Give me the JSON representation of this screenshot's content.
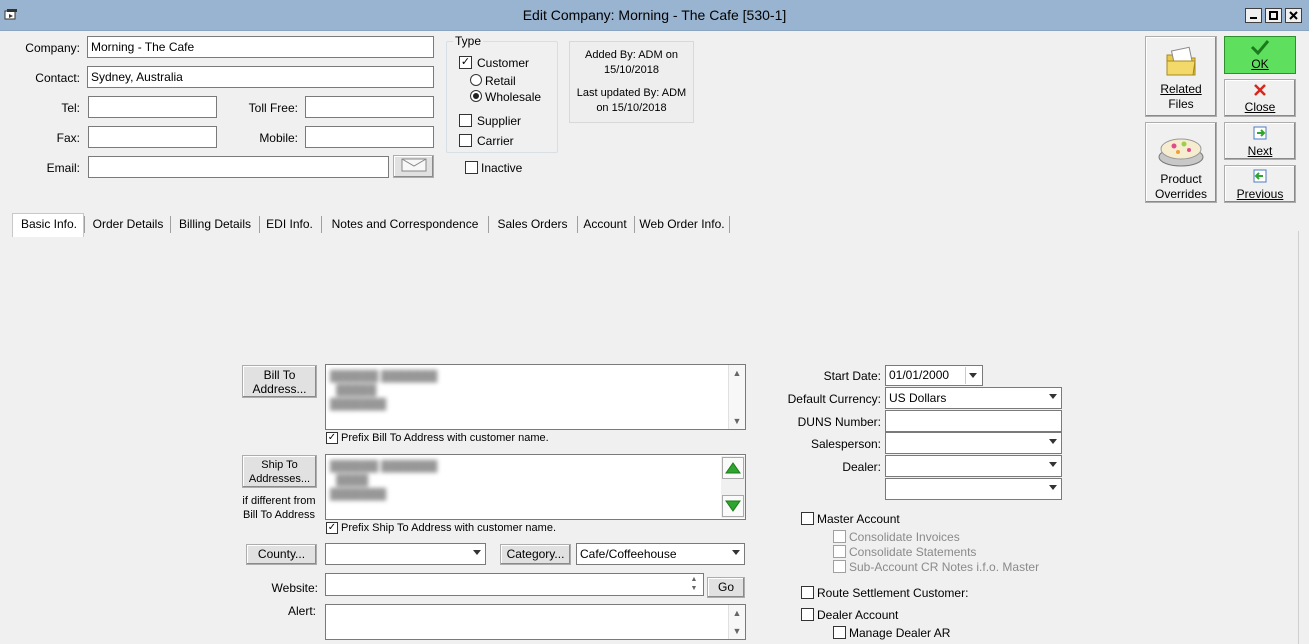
{
  "window": {
    "title": "Edit Company: Morning - The Cafe [530-1]"
  },
  "header": {
    "company_label": "Company:",
    "company_value": "Morning - The Cafe",
    "contact_label": "Contact:",
    "contact_value": "Sydney, Australia",
    "tel_label": "Tel:",
    "tel_value": "",
    "tollfree_label": "Toll Free:",
    "tollfree_value": "",
    "fax_label": "Fax:",
    "fax_value": "",
    "mobile_label": "Mobile:",
    "mobile_value": "",
    "email_label": "Email:",
    "email_value": ""
  },
  "type": {
    "group_label": "Type",
    "customer": {
      "label": "Customer",
      "checked": true
    },
    "retail": {
      "label": "Retail",
      "selected": false
    },
    "wholesale": {
      "label": "Wholesale",
      "selected": true
    },
    "supplier": {
      "label": "Supplier",
      "checked": false
    },
    "carrier": {
      "label": "Carrier",
      "checked": false
    },
    "inactive": {
      "label": "Inactive",
      "checked": false
    }
  },
  "audit": {
    "added_line1": "Added By: ADM on",
    "added_line2": "15/10/2018",
    "updated_line1": "Last updated By: ADM",
    "updated_line2": "on 15/10/2018"
  },
  "actions": {
    "related_files_1": "Related",
    "related_files_2": "Files",
    "product_overrides_1": "Product",
    "product_overrides_2": "Overrides",
    "ok": "OK",
    "close": "Close",
    "next": "Next",
    "previous": "Previous"
  },
  "tabs": [
    {
      "label": "Basic Info.",
      "active": true
    },
    {
      "label": "Order Details"
    },
    {
      "label": "Billing Details"
    },
    {
      "label": "EDI Info."
    },
    {
      "label": "Notes and Correspondence"
    },
    {
      "label": "Sales Orders"
    },
    {
      "label": "Account"
    },
    {
      "label": "Web Order Info."
    }
  ],
  "basic": {
    "bill_to_btn_1": "Bill To",
    "bill_to_btn_2": "Address...",
    "prefix_bill": "Prefix Bill To Address with customer name.",
    "ship_to_btn_1": "Ship To",
    "ship_to_btn_2": "Addresses...",
    "ship_note_1": "if different from",
    "ship_note_2": "Bill To Address",
    "prefix_ship": "Prefix Ship To Address with customer name.",
    "county_btn": "County...",
    "county_value": "",
    "category_btn": "Category...",
    "category_value": "Cafe/Coffeehouse",
    "website_label": "Website:",
    "website_value": "",
    "go_btn": "Go",
    "alert_label": "Alert:",
    "alert_value": ""
  },
  "right": {
    "start_date_label": "Start Date:",
    "start_date_value": "01/01/2000",
    "currency_label": "Default Currency:",
    "currency_value": "US Dollars",
    "duns_label": "DUNS Number:",
    "duns_value": "",
    "salesperson_label": "Salesperson:",
    "salesperson_value": "",
    "dealer_label": "Dealer:",
    "dealer_value": "",
    "extra_value": "",
    "master_account": "Master Account",
    "consolidate_invoices": "Consolidate Invoices",
    "consolidate_statements": "Consolidate Statements",
    "sub_account_cr": "Sub-Account CR Notes i.f.o. Master",
    "route_settlement": "Route Settlement Customer:",
    "dealer_account": "Dealer Account",
    "manage_dealer_ar": "Manage Dealer AR"
  },
  "colors": {
    "titlebar": "#99b4d1",
    "ok_green": "#5ee05e",
    "arrow_green": "#2fa52f",
    "close_red": "#d9261c"
  }
}
